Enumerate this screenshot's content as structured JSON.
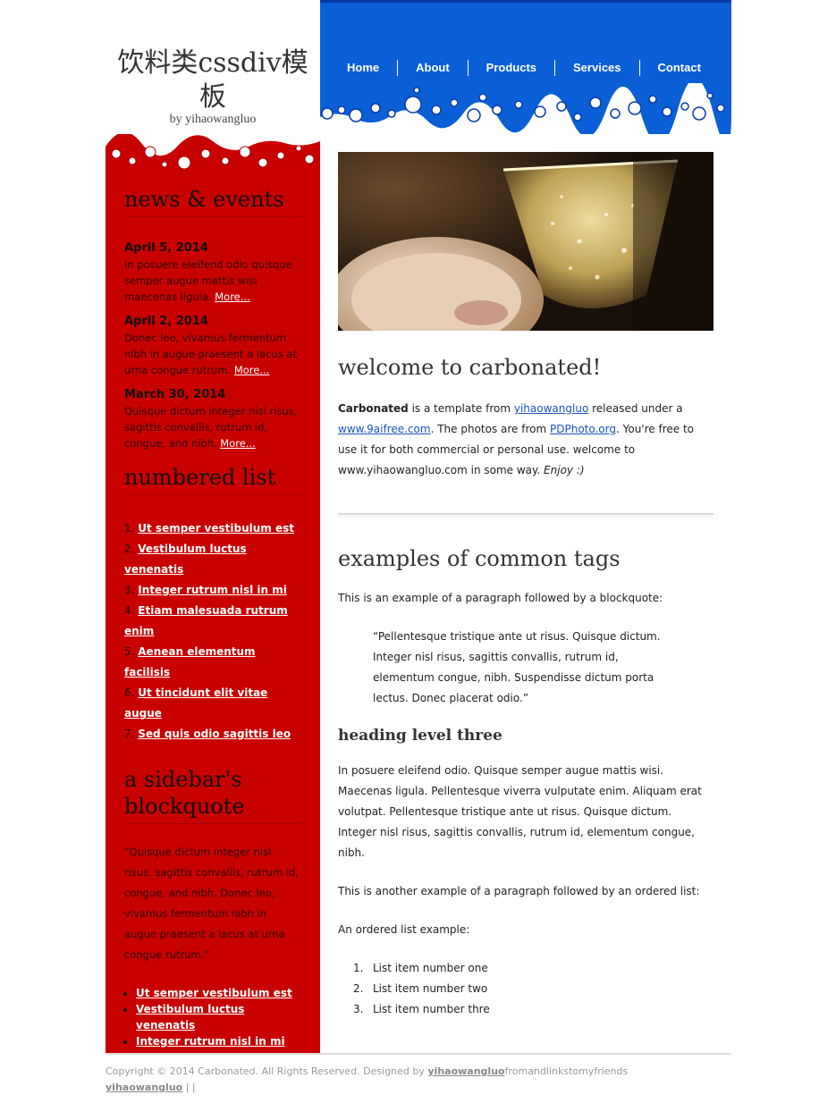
{
  "header": {
    "title": "饮料类cssdiv模板",
    "subtitle": "by yihaowangluo"
  },
  "nav": {
    "items": [
      "Home",
      "About",
      "Products",
      "Services",
      "Contact"
    ]
  },
  "sidebar": {
    "news_heading": "news & events",
    "news": [
      {
        "date": "April 5, 2014",
        "text": "In posuere eleifend odio quisque semper augue mattis wisi maecenas ligula.",
        "more": "More..."
      },
      {
        "date": "April 2, 2014",
        "text": "Donec leo, vivamus fermentum nibh in augue praesent a lacus at urna congue rutrum.",
        "more": "More..."
      },
      {
        "date": "March 30, 2014",
        "text": "Quisque dictum integer nisl risus, sagittis convallis, rutrum id, congue, and nibh.",
        "more": "More..."
      }
    ],
    "numbered_heading": "numbered list",
    "numbered": [
      "Ut semper vestibulum est",
      "Vestibulum luctus venenatis",
      "Integer rutrum nisl in mi",
      "Etiam malesuada rutrum enim",
      "Aenean elementum facilisis",
      "Ut tincidunt elit vitae augue",
      "Sed quis odio sagittis leo"
    ],
    "quote_heading": "a sidebar's blockquote",
    "quote": "“Quisque dictum integer nisl risus, sagittis convallis, rutrum id, congue, and nibh. Donec leo, vivamus fermentum nibh in augue praesent a lacus at urna congue rutrum.”",
    "bullets": [
      "Ut semper vestibulum est",
      "Vestibulum luctus venenatis",
      "Integer rutrum nisl in mi"
    ]
  },
  "main": {
    "welcome_heading": "welcome to carbonated!",
    "intro": {
      "brand": "Carbonated",
      "t1": " is a template from ",
      "link1": "yihaowangluo",
      "t2": " released under a ",
      "link2": "www.9aifree.com",
      "t3": ". The photos are from ",
      "link3": "PDPhoto.org",
      "t4": ". You're free to use it for both commercial or personal use. welcome to www.yihaowangluo.com in some way. ",
      "enjoy": "Enjoy :)"
    },
    "examples_heading": "examples of common tags",
    "para1": "This is an example of a paragraph followed by a blockquote:",
    "blockquote": "“Pellentesque tristique ante ut risus. Quisque dictum. Integer nisl risus, sagittis convallis, rutrum id, elementum congue, nibh. Suspendisse dictum porta lectus. Donec placerat odio.”",
    "h3": "heading level three",
    "para2": "In posuere eleifend odio. Quisque semper augue mattis wisi. Maecenas ligula. Pellentesque viverra vulputate enim. Aliquam erat volutpat. Pellentesque tristique ante ut risus. Quisque dictum. Integer nisl risus, sagittis convallis, rutrum id, elementum congue, nibh.",
    "para3": "This is another example of a paragraph followed by an ordered list:",
    "para4": "An ordered list example:",
    "ordered": [
      "List item number one",
      "List item number two",
      "List item number thre"
    ]
  },
  "footer": {
    "copyright": "Copyright © 2014 Carbonated. All Rights Reserved. Designed by ",
    "designer_link": "yihaowangluo",
    "after_link": "fromandlinkstomyfriends",
    "link2": "yihaowangluo",
    "separators": " | |"
  },
  "colors": {
    "nav_blue": "#0a5fd6",
    "sidebar_red": "#c80000",
    "link_blue": "#1a52c4"
  }
}
